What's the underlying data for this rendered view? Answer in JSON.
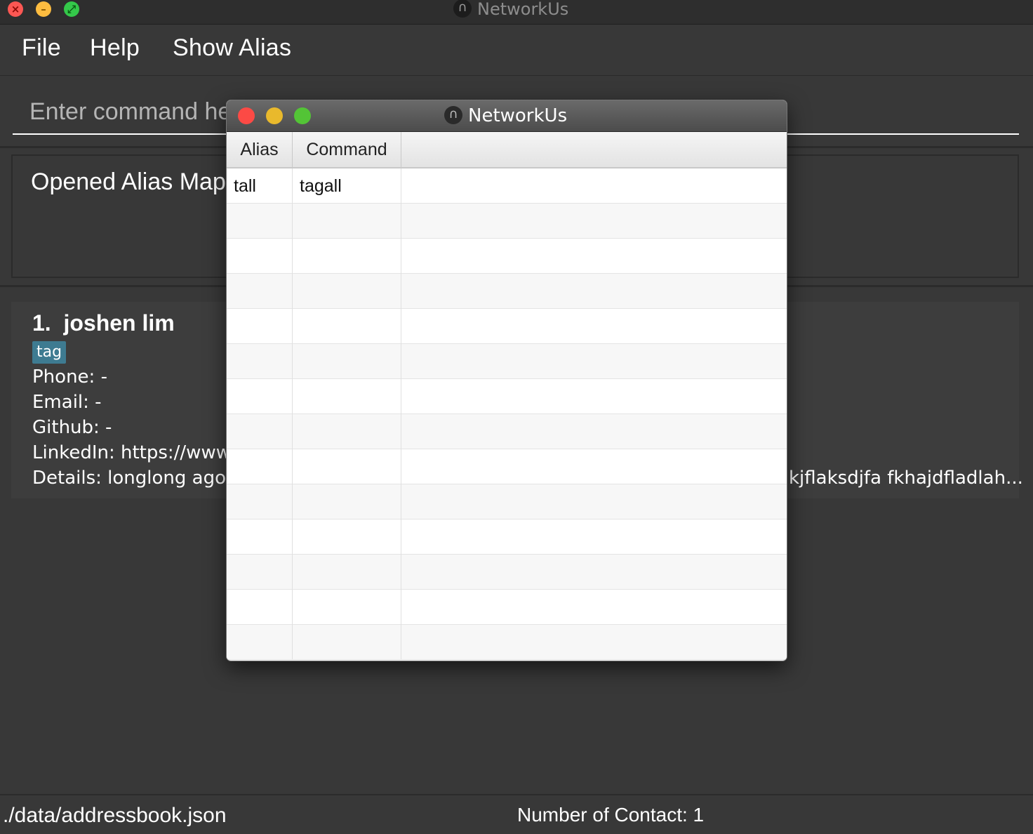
{
  "window": {
    "title": "NetworkUs",
    "app_icon_glyph": "∩"
  },
  "menu": {
    "items": [
      "File",
      "Help",
      "Show Alias"
    ]
  },
  "command_box": {
    "placeholder": "Enter command here...",
    "value": ""
  },
  "result": {
    "text": "Opened Alias Map"
  },
  "contact": {
    "index": "1.",
    "name": "joshen lim",
    "tags": [
      "tag"
    ],
    "phone": "Phone: -",
    "email": "Email: -",
    "github": "Github: -",
    "linkedin": "LinkedIn: https://www.",
    "details_start": "Details: longlong ago th",
    "details_end": "kjflaksdjfa fkhajdfladlah..."
  },
  "status": {
    "path": "./data/addressbook.json",
    "contact_count": "Number of Contact: 1"
  },
  "alias_window": {
    "title": "NetworkUs",
    "columns": [
      "Alias",
      "Command"
    ],
    "rows": [
      {
        "alias": "tall",
        "command": "tagall"
      }
    ]
  },
  "colors": {
    "background": "#383838",
    "tag_bg": "#3e7b91",
    "close": "#fc5753",
    "minimize": "#fdbc40",
    "zoom": "#34c84a"
  }
}
